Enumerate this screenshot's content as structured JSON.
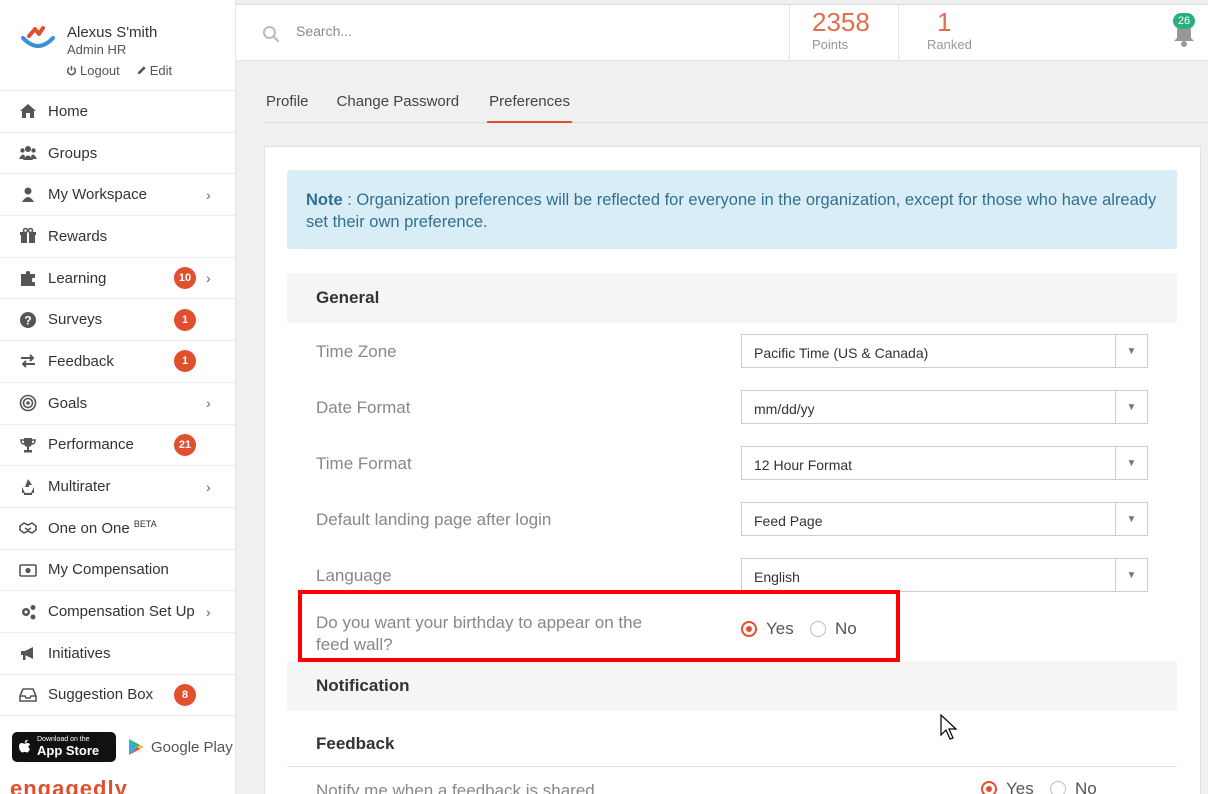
{
  "user": {
    "name": "Alexus S'mith",
    "role": "Admin HR",
    "logout": "Logout",
    "edit": "Edit"
  },
  "nav": [
    {
      "label": "Home",
      "icon": "home-icon"
    },
    {
      "label": "Groups",
      "icon": "users-icon"
    },
    {
      "label": "My Workspace",
      "icon": "user-icon",
      "chevron": true
    },
    {
      "label": "Rewards",
      "icon": "gift-icon"
    },
    {
      "label": "Learning",
      "icon": "puzzle-icon",
      "badge": "10",
      "chevron": true
    },
    {
      "label": "Surveys",
      "icon": "question-icon",
      "badge": "1"
    },
    {
      "label": "Feedback",
      "icon": "exchange-icon",
      "badge": "1"
    },
    {
      "label": "Goals",
      "icon": "target-icon",
      "chevron": true
    },
    {
      "label": "Performance",
      "icon": "trophy-icon",
      "badge": "21"
    },
    {
      "label": "Multirater",
      "icon": "recycle-icon",
      "chevron": true
    },
    {
      "label": "One on One",
      "sup": "BETA",
      "icon": "handshake-icon"
    },
    {
      "label": "My Compensation",
      "icon": "money-icon"
    },
    {
      "label": "Compensation Set Up",
      "icon": "gears-icon",
      "chevron": true
    },
    {
      "label": "Initiatives",
      "icon": "bullhorn-icon"
    },
    {
      "label": "Suggestion Box",
      "icon": "inbox-icon",
      "badge": "8"
    }
  ],
  "stores": {
    "appstore_small": "Download on the",
    "appstore_big": "App Store",
    "googleplay": "Google Play"
  },
  "brand": "engagedly",
  "search": {
    "placeholder": "Search..."
  },
  "stats": {
    "points_value": "2358",
    "points_label": "Points",
    "ranked_value": "1",
    "ranked_label": "Ranked"
  },
  "notifications": {
    "count": "26"
  },
  "tabs": [
    "Profile",
    "Change Password",
    "Preferences"
  ],
  "note": {
    "bold": "Note",
    "text": " : Organization preferences will be reflected for everyone in the organization, except for those who have already set their own preference."
  },
  "general": {
    "title": "General",
    "rows": [
      {
        "label": "Time Zone",
        "value": "Pacific Time (US & Canada)"
      },
      {
        "label": "Date Format",
        "value": "mm/dd/yy"
      },
      {
        "label": "Time Format",
        "value": "12 Hour Format"
      },
      {
        "label": "Default landing page after login",
        "value": "Feed Page"
      },
      {
        "label": "Language",
        "value": "English"
      }
    ],
    "birthday": {
      "label_line1": "Do you want your birthday to appear on the",
      "label_line2": "feed wall?",
      "yes": "Yes",
      "no": "No",
      "selected": "Yes"
    }
  },
  "notification": {
    "title": "Notification"
  },
  "feedback": {
    "title": "Feedback",
    "row_label": "Notify me when a feedback is shared",
    "yes": "Yes",
    "no": "No",
    "selected": "Yes"
  },
  "colors": {
    "accent": "#e0502f",
    "highlight": "#ff0000",
    "note_bg": "#d9edf7",
    "badge_green": "#2ab07e"
  }
}
